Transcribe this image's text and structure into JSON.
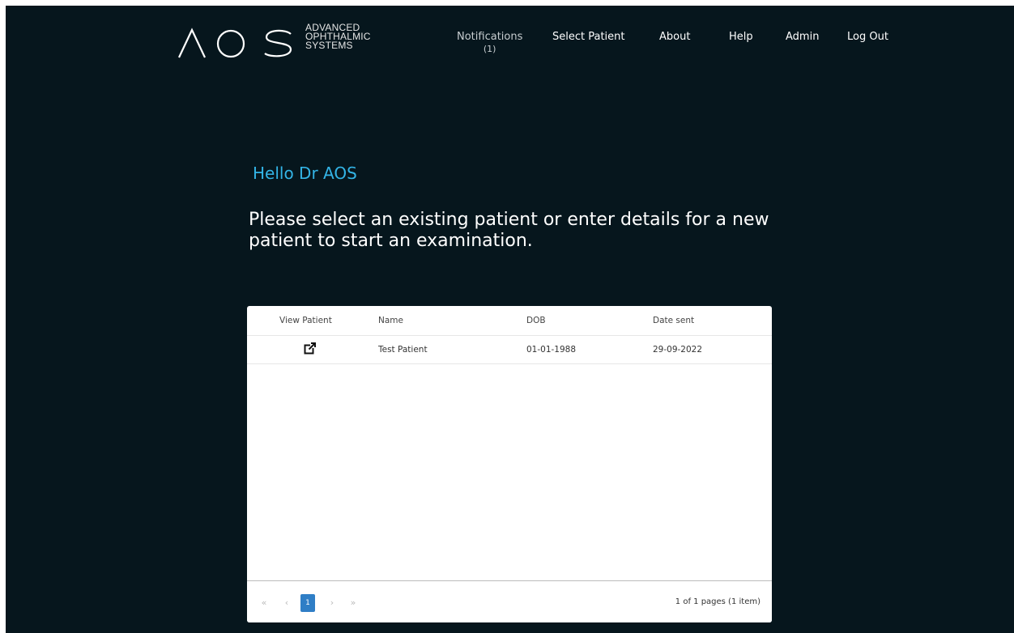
{
  "brand": {
    "logo": "AOS",
    "name_lines": [
      "ADVANCED",
      "OPHTHALMIC",
      "SYSTEMS"
    ]
  },
  "nav": {
    "notifications": "Notifications",
    "notifications_count": "(1)",
    "select_patient": "Select Patient",
    "about": "About",
    "help": "Help",
    "admin": "Admin",
    "logout": "Log Out"
  },
  "greeting": "Hello Dr AOS",
  "prompt": "Please select an existing patient or enter details for a new patient to start an examination.",
  "table": {
    "columns": [
      "View Patient",
      "Name",
      "DOB",
      "Date sent"
    ],
    "rows": [
      {
        "view_icon": "open-external-icon",
        "name": "Test Patient",
        "dob": "01-01-1988",
        "date_sent": "29-09-2022"
      }
    ]
  },
  "pager": {
    "first": "«",
    "prev": "‹",
    "current_page": "1",
    "next": "›",
    "last": "»",
    "info": "1 of 1 pages (1 item)"
  },
  "colors": {
    "background": "#06161d",
    "accent": "#33b4e6",
    "pager_active": "#2f7ec6"
  }
}
